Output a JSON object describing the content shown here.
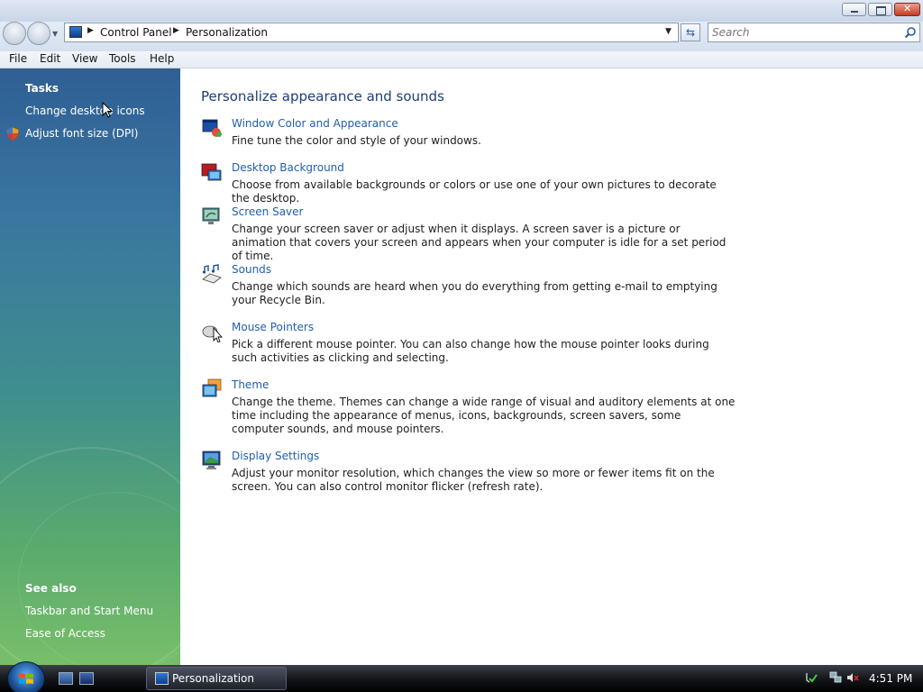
{
  "window": {
    "controls": {
      "minimize": "minimize",
      "maximize": "maximize",
      "close": "close"
    }
  },
  "address": {
    "breadcrumbs": [
      "Control Panel",
      "Personalization"
    ],
    "search_placeholder": "Search"
  },
  "menu": [
    "File",
    "Edit",
    "View",
    "Tools",
    "Help"
  ],
  "sidebar": {
    "tasks_heading": "Tasks",
    "tasks": [
      "Change desktop icons",
      "Adjust font size (DPI)"
    ],
    "see_also_heading": "See also",
    "see_also": [
      "Taskbar and Start Menu",
      "Ease of Access"
    ]
  },
  "main": {
    "title": "Personalize appearance and sounds",
    "items": [
      {
        "link": "Window Color and Appearance",
        "desc": "Fine tune the color and style of your windows.",
        "icon": "window-color-icon"
      },
      {
        "link": "Desktop Background",
        "desc": "Choose from available backgrounds or colors or use one of your own pictures to decorate the desktop.",
        "icon": "desktop-background-icon"
      },
      {
        "link": "Screen Saver",
        "desc": "Change your screen saver or adjust when it displays. A screen saver is a picture or animation that covers your screen and appears when your computer is idle for a set period of time.",
        "icon": "screen-saver-icon"
      },
      {
        "link": "Sounds",
        "desc": "Change which sounds are heard when you do everything from getting e-mail to emptying your Recycle Bin.",
        "icon": "sounds-icon"
      },
      {
        "link": "Mouse Pointers",
        "desc": "Pick a different mouse pointer. You can also change how the mouse pointer looks during such activities as clicking and selecting.",
        "icon": "mouse-pointers-icon"
      },
      {
        "link": "Theme",
        "desc": "Change the theme. Themes can change a wide range of visual and auditory elements at one time including the appearance of menus, icons, backgrounds, screen savers, some computer sounds, and mouse pointers.",
        "icon": "theme-icon"
      },
      {
        "link": "Display Settings",
        "desc": "Adjust your monitor resolution, which changes the view so more or fewer items fit on the screen. You can also control monitor flicker (refresh rate).",
        "icon": "display-settings-icon"
      }
    ]
  },
  "taskbar": {
    "window_label": "Personalization",
    "clock": "4:51 PM"
  },
  "colors": {
    "link": "#1f5fb0",
    "title": "#1d3d7a",
    "sidebar_top": "#2f5f94",
    "sidebar_bottom": "#78bf6a"
  }
}
